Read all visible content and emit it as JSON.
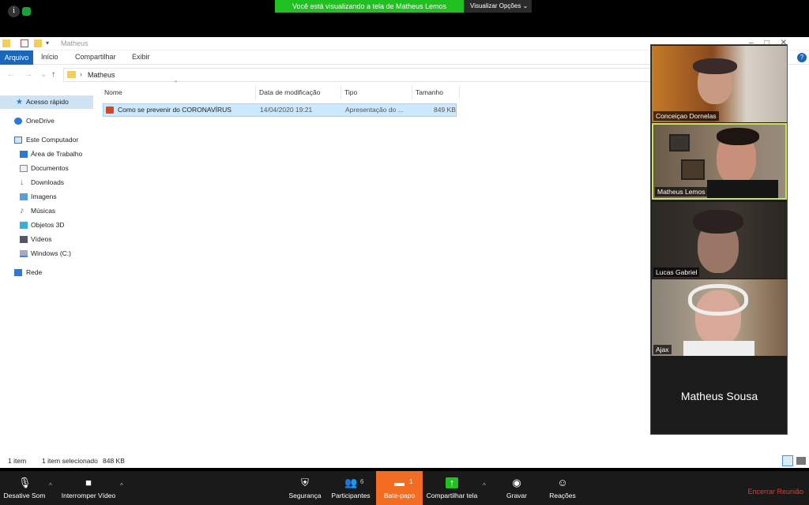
{
  "zoom": {
    "share_banner": "Você está visualizando a tela de Matheus Lemos",
    "view_options": "Visualizar Opções",
    "view_options_caret": "⌄"
  },
  "explorer": {
    "title": "Matheus",
    "ribbon_tabs": [
      "Arquivo",
      "Início",
      "Compartilhar",
      "Exibir"
    ],
    "help": "?",
    "address_path": "Matheus",
    "nav": [
      {
        "label": "Acesso rápido",
        "icon": "star-icon"
      },
      {
        "label": "OneDrive",
        "icon": "cloud-icon"
      },
      {
        "label": "Este Computador",
        "icon": "computer-icon"
      },
      {
        "label": "Área de Trabalho",
        "icon": "desktop-icon"
      },
      {
        "label": "Documentos",
        "icon": "documents-icon"
      },
      {
        "label": "Downloads",
        "icon": "download-icon"
      },
      {
        "label": "Imagens",
        "icon": "pictures-icon"
      },
      {
        "label": "Músicas",
        "icon": "music-icon"
      },
      {
        "label": "Objetos 3D",
        "icon": "cube-icon"
      },
      {
        "label": "Vídeos",
        "icon": "video-icon"
      },
      {
        "label": "Windows (C:)",
        "icon": "drive-icon"
      },
      {
        "label": "Rede",
        "icon": "network-icon"
      }
    ],
    "columns": [
      "Nome",
      "Data de modificação",
      "Tipo",
      "Tamanho"
    ],
    "file": {
      "name": "Como se prevenir do CORONAVÍRUS",
      "modified": "14/04/2020 19:21",
      "type": "Apresentação do ...",
      "size": "849 KB"
    },
    "status": {
      "count": "1 item",
      "selected": "1 item selecionado",
      "size": "848 KB"
    }
  },
  "participants": [
    {
      "name": "Conceiçao Dornelas"
    },
    {
      "name": "Matheus Lemos"
    },
    {
      "name": "Lucas Gabriel"
    },
    {
      "name": "Ajax"
    }
  ],
  "name_card": "Matheus Sousa",
  "toolbar": {
    "mute": "Desative Som",
    "video": "Interromper Vídeo",
    "security": "Segurança",
    "participants": "Participantes",
    "participants_count": "6",
    "chat": "Bate-papo",
    "chat_count": "1",
    "share": "Compartilhar tela",
    "record": "Gravar",
    "reactions": "Reações",
    "end": "Encerrar Reunião"
  },
  "colors": {
    "banner": "#1fc01f",
    "chat_active": "#f26d21",
    "end": "#e53935",
    "active_speaker": "#c8e64d"
  }
}
